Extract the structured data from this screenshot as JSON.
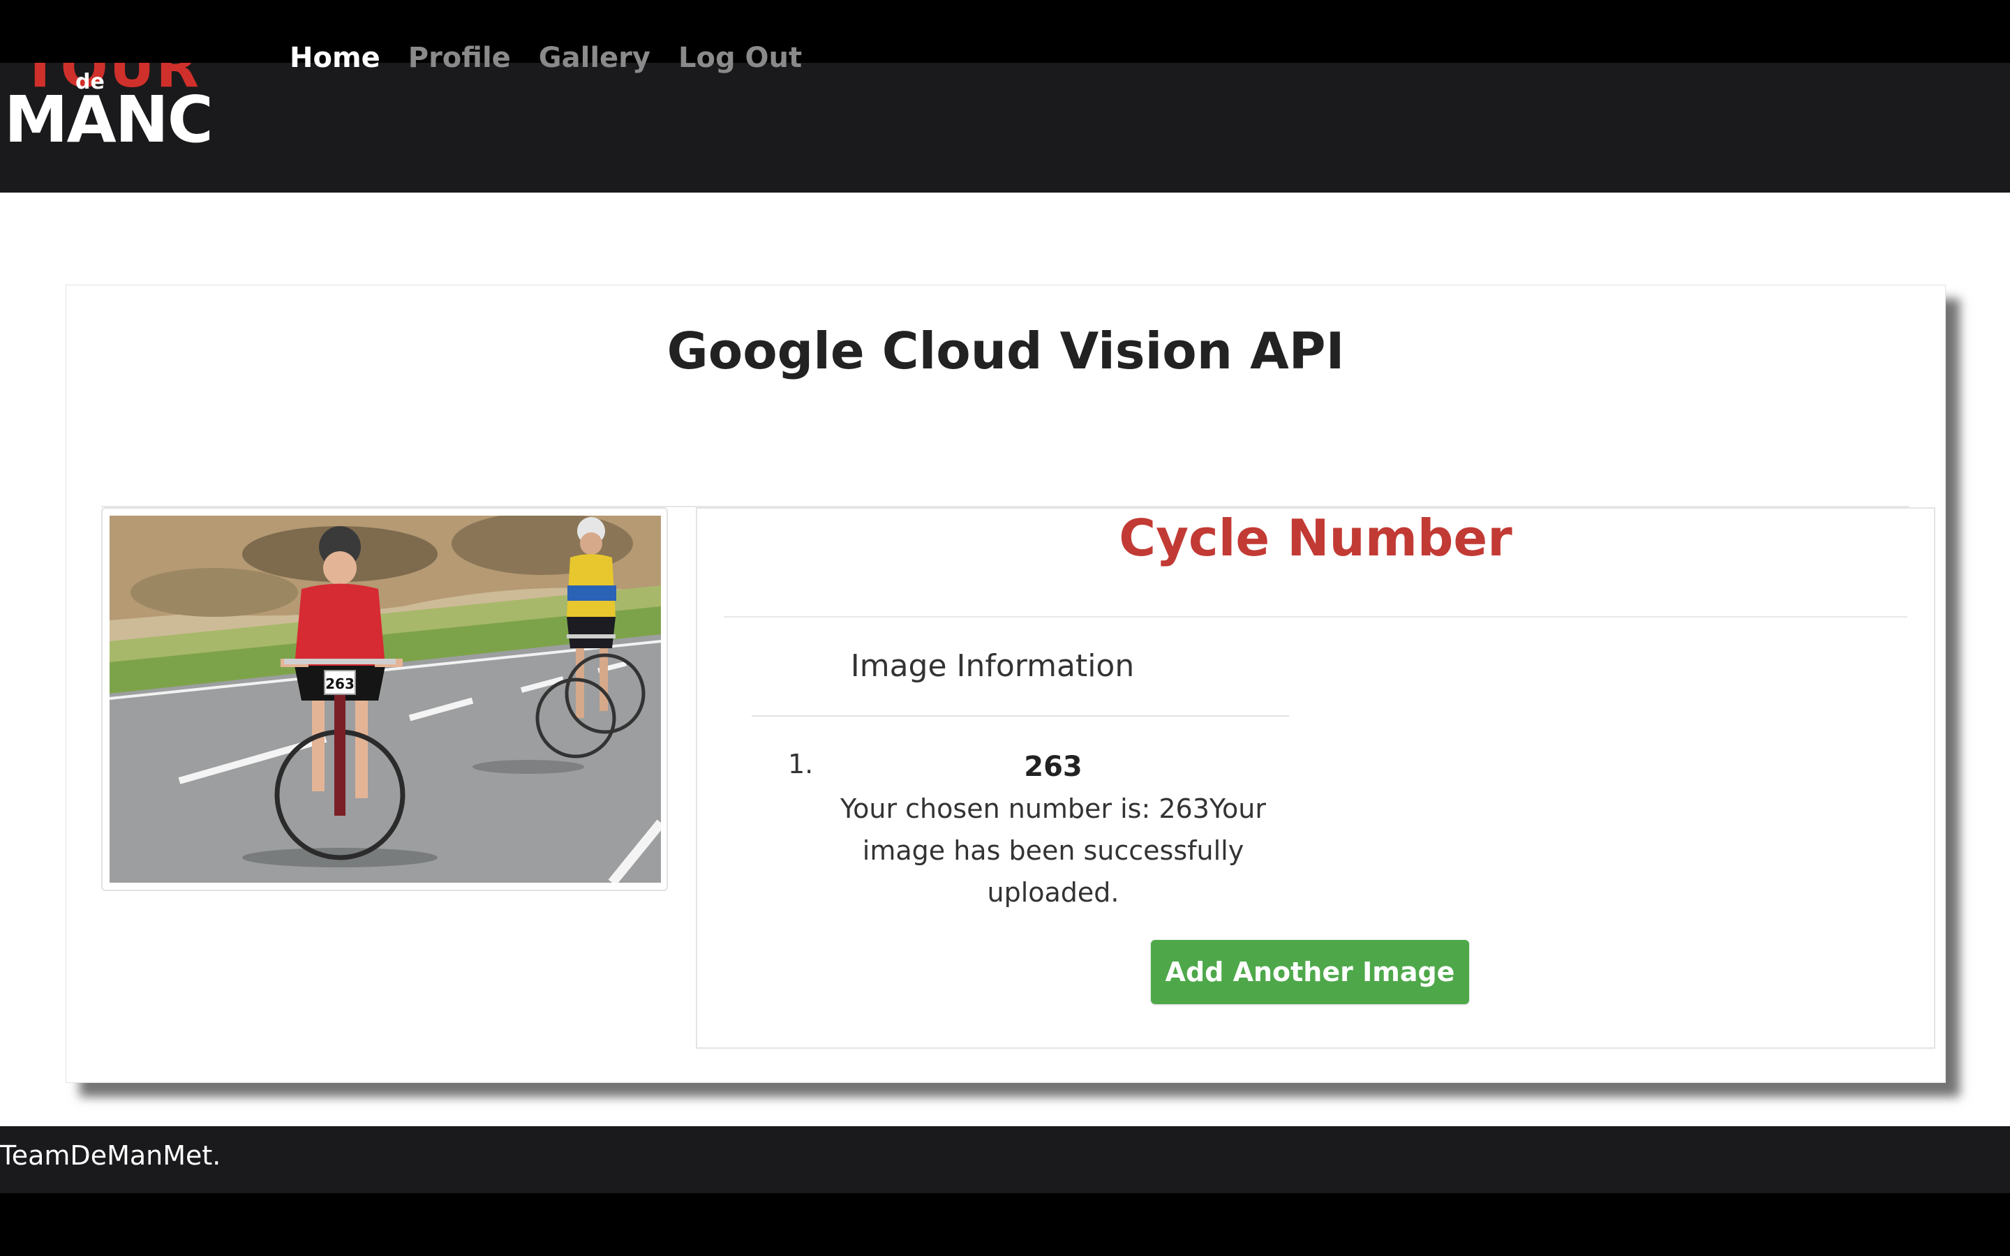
{
  "logo": {
    "top_text": "TOUR",
    "de_text": "de",
    "main_text": "MANC"
  },
  "nav": {
    "items": [
      {
        "label": "Home",
        "active": true
      },
      {
        "label": "Profile",
        "active": false
      },
      {
        "label": "Gallery",
        "active": false
      },
      {
        "label": "Log Out",
        "active": false
      }
    ]
  },
  "card": {
    "title": "Google Cloud Vision API",
    "photo_race_number": "263"
  },
  "result_panel": {
    "title": "Cycle Number",
    "info_heading": "Image Information",
    "list_marker": "1.",
    "detected_number": "263",
    "message": "Your chosen number is: 263Your image has been successfully uploaded.",
    "button_label": "Add Another Image"
  },
  "footer": {
    "text": "TeamDeManMet."
  },
  "colors": {
    "navbar_bg": "#1a1a1c",
    "brand_red": "#c23a34",
    "button_green": "#4ea84a"
  }
}
